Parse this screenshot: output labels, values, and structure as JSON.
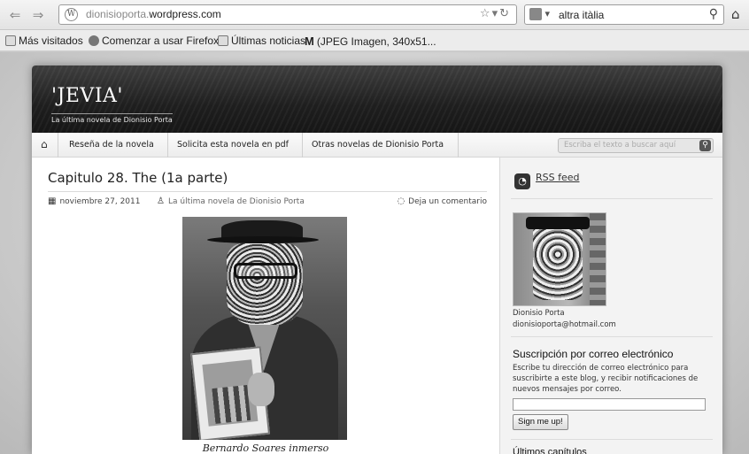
{
  "browser": {
    "url_domain": "dionisioporta.",
    "url_rest": "wordpress.com",
    "search_query": "altra itàlia",
    "bookmarks": [
      "Más visitados",
      "Comenzar a usar Firefox",
      "Últimas noticias",
      "(JPEG Imagen, 340x51..."
    ]
  },
  "site": {
    "title": "'JEVIA'",
    "tagline": "La última novela de Dionisio Porta",
    "menu": [
      "Reseña de la novela",
      "Solicita esta novela en pdf",
      "Otras novelas de Dionisio Porta"
    ],
    "search_placeholder": "Escriba el texto a buscar aquí"
  },
  "post": {
    "title": "Capitulo 28. The (1a parte)",
    "date": "noviembre 27, 2011",
    "author": "La última novela de Dionisio Porta",
    "comment_link": "Deja un comentario",
    "caption": "Bernardo Soares inmerso"
  },
  "sidebar": {
    "rss_label": "RSS feed",
    "author_name": "Dionisio Porta",
    "author_email": "dionisioporta@hotmail.com",
    "subscription_title": "Suscripción por correo electrónico",
    "subscription_desc": "Escribe tu dirección de correo electrónico para suscribirte a este blog, y recibir notificaciones de nuevos mensajes por correo.",
    "signup_button": "Sign me up!",
    "last_chapters_title": "Últimos capítulos"
  },
  "icons": {
    "back": "back-arrow-icon",
    "forward": "forward-arrow-icon",
    "home": "home-icon",
    "rss": "rss-icon"
  }
}
